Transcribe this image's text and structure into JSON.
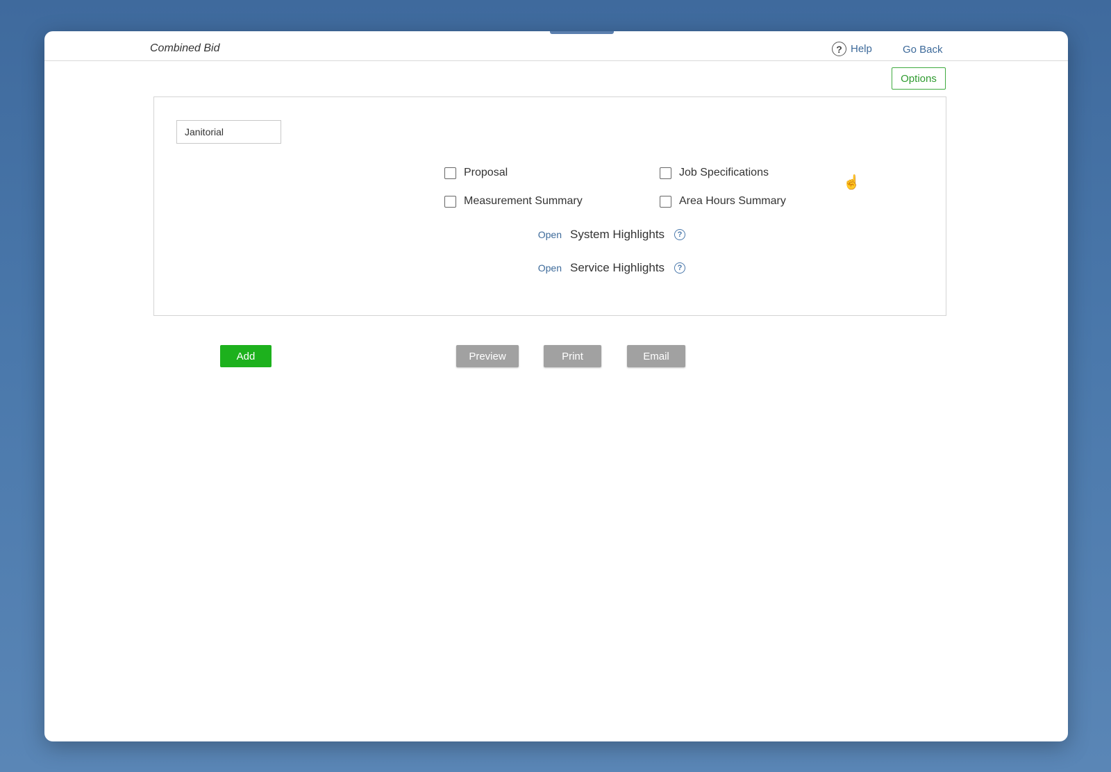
{
  "header": {
    "title": "Combined Bid",
    "help_label": "Help",
    "help_icon": "question-circle-icon",
    "go_back_label": "Go Back"
  },
  "toolbar": {
    "options_label": "Options"
  },
  "panel": {
    "name_value": "Janitorial",
    "checkboxes": [
      {
        "label": "Proposal",
        "checked": false
      },
      {
        "label": "Job Specifications",
        "checked": false
      },
      {
        "label": "Measurement Summary",
        "checked": false
      },
      {
        "label": "Area Hours Summary",
        "checked": false
      }
    ],
    "highlights": [
      {
        "open_label": "Open",
        "label": "System Highlights",
        "icon": "help-icon"
      },
      {
        "open_label": "Open",
        "label": "Service Highlights",
        "icon": "help-icon"
      }
    ]
  },
  "actions": {
    "add_label": "Add",
    "preview_label": "Preview",
    "print_label": "Print",
    "email_label": "Email"
  },
  "colors": {
    "accent_green": "#1db11d",
    "link_blue": "#3d6a9a",
    "button_gray": "#a1a1a1",
    "background_blue": "#4a78ab"
  }
}
